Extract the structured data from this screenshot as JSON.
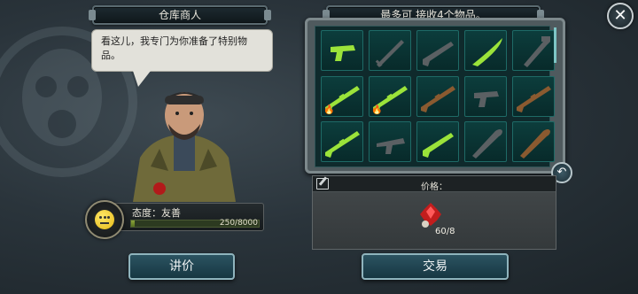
{
  "header": {
    "merchant_title": "仓库商人",
    "inventory_title": "最多可 接收4个物品。"
  },
  "close_button": {
    "label": "✕"
  },
  "merchant": {
    "speech": "看这儿，我专门为你准备了特别物品。",
    "attitude_label": "态度：友善",
    "attitude_value": "250/8000",
    "attitude_progress": 0.031
  },
  "buttons": {
    "bargain": "讲价",
    "trade": "交易",
    "back": "↶"
  },
  "inventory": {
    "items": [
      {
        "icon": "pistol-green-icon",
        "burning": false
      },
      {
        "icon": "sword-icon",
        "burning": false
      },
      {
        "icon": "shotgun-icon",
        "burning": false
      },
      {
        "icon": "machete-green-icon",
        "burning": false
      },
      {
        "icon": "pipe-wrench-icon",
        "burning": false
      },
      {
        "icon": "rifle-green-icon",
        "burning": true
      },
      {
        "icon": "crossbow-rifle-green-icon",
        "burning": true
      },
      {
        "icon": "hunting-rifle-icon",
        "burning": false
      },
      {
        "icon": "pistol-black-icon",
        "burning": false
      },
      {
        "icon": "assault-rifle-icon",
        "burning": false
      },
      {
        "icon": "sniper-rifle-green-icon",
        "burning": false
      },
      {
        "icon": "submachine-gun-icon",
        "burning": false
      },
      {
        "icon": "shotgun-green-icon",
        "burning": false
      },
      {
        "icon": "combat-rifle-icon",
        "burning": false
      },
      {
        "icon": "baseball-bat-icon",
        "burning": false
      }
    ]
  },
  "price": {
    "label": "价格：",
    "value": "60/8",
    "currency_icon": "red-crystal-icon"
  }
}
